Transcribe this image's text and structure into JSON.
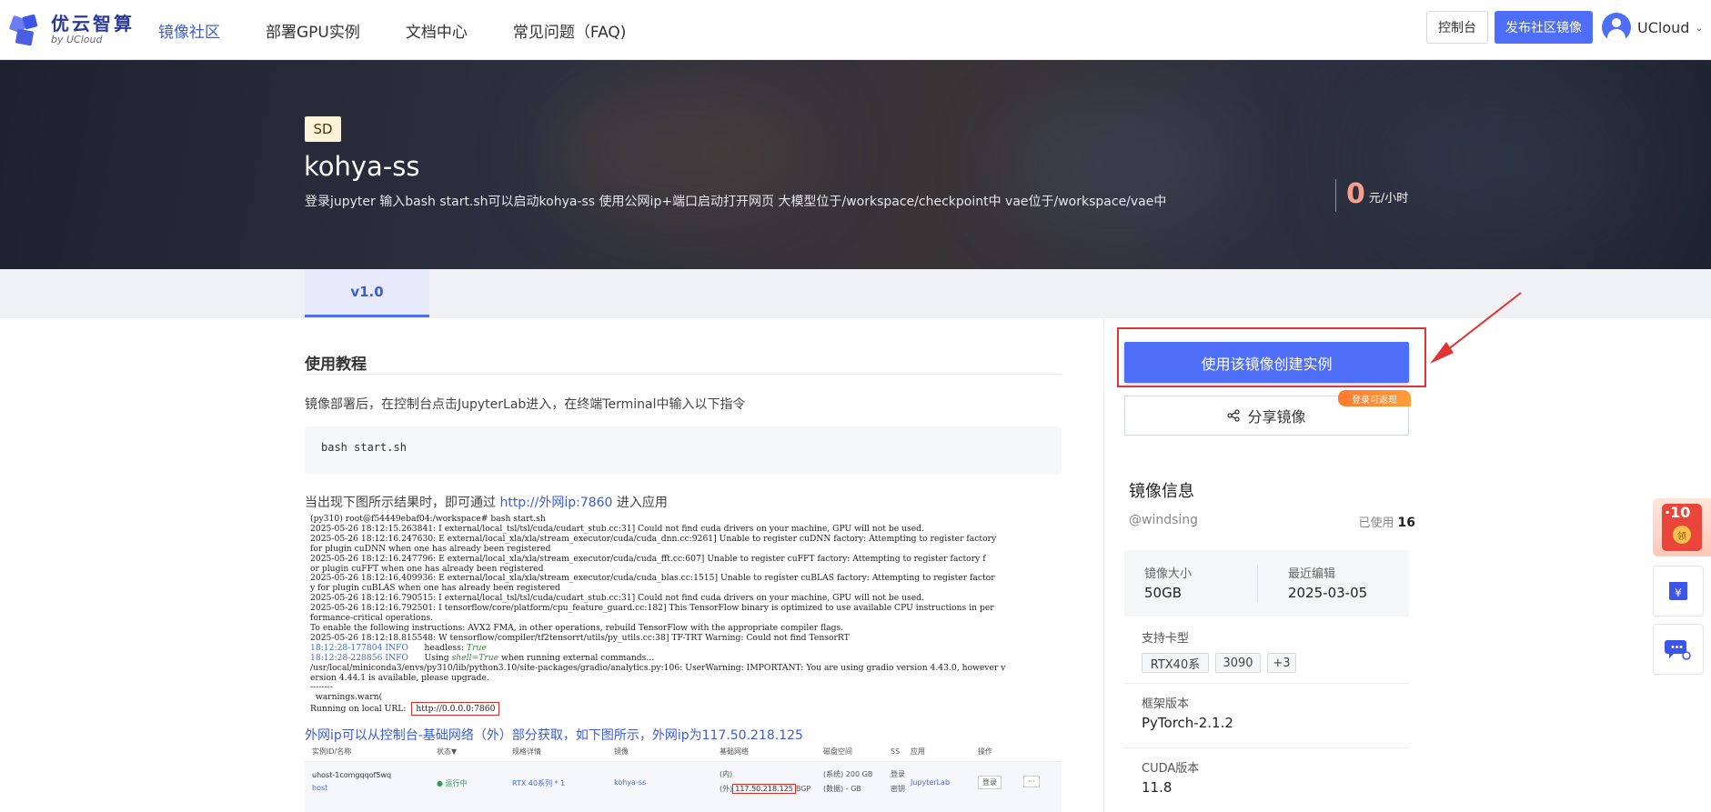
{
  "header": {
    "logo_main": "优云智算",
    "logo_sub": "by UCloud",
    "nav": [
      {
        "label": "镜像社区",
        "active": true
      },
      {
        "label": "部署GPU实例",
        "active": false
      },
      {
        "label": "文档中心",
        "active": false
      },
      {
        "label": "常见问题（FAQ)",
        "active": false
      }
    ],
    "console_btn": "控制台",
    "publish_btn": "发布社区镜像",
    "user_name": "UCloud"
  },
  "hero": {
    "tag": "SD",
    "title": "kohya-ss",
    "description": "登录jupyter 输入bash start.sh可以启动kohya-ss 使用公网ip+端口启动打开网页 大模型位于/workspace/checkpoint中 vae位于/workspace/vae中",
    "price_value": "0",
    "price_unit": "元/小时"
  },
  "tabs": [
    {
      "label": "v1.0",
      "active": true
    }
  ],
  "tutorial": {
    "title": "使用教程",
    "step1": "镜像部署后，在控制台点击JupyterLab进入，在终端Terminal中输入以下指令",
    "command": "bash start.sh",
    "step2_prefix": "当出现下图所示结果时，即可通过 ",
    "step2_link": "http://外网ip:7860",
    "step2_suffix": " 进入应用",
    "terminal_lines": [
      "(py310) root@f54449ebaf04:/workspace# bash start.sh",
      "2025-05-26 18:12:15.263841: I external/local_tsl/tsl/cuda/cudart_stub.cc:31] Could not find cuda drivers on your machine, GPU will not be used.",
      "2025-05-26 18:12:16.247630: E external/local_xla/xla/stream_executor/cuda/cuda_dnn.cc:9261] Unable to register cuDNN factory: Attempting to register factory",
      "for plugin cuDNN when one has already been registered",
      "2025-05-26 18:12:16.247796: E external/local_xla/xla/stream_executor/cuda/cuda_fft.cc:607] Unable to register cuFFT factory: Attempting to register factory f",
      "or plugin cuFFT when one has already been registered",
      "2025-05-26 18:12:16.409936: E external/local_xla/xla/stream_executor/cuda/cuda_blas.cc:1515] Unable to register cuBLAS factory: Attempting to register factor",
      "y for plugin cuBLAS when one has already been registered",
      "2025-05-26 18:12:16.790515: I external/local_tsl/tsl/cuda/cudart_stub.cc:31] Could not find cuda drivers on your machine, GPU will not be used.",
      "2025-05-26 18:12:16.792501: I tensorflow/core/platform/cpu_feature_guard.cc:182] This TensorFlow binary is optimized to use available CPU instructions in per",
      "formance-critical operations.",
      "To enable the following instructions: AVX2 FMA, in other operations, rebuild TensorFlow with the appropriate compiler flags.",
      "2025-05-26 18:12:18.815548: W tensorflow/compiler/tf2tensorrt/utils/py_utils.cc:38] TF-TRT Warning: Could not find TensorRT"
    ],
    "terminal_info1_time": "18:12:28-177804 INFO",
    "terminal_info1_key": "headless: ",
    "terminal_info1_val": "True",
    "terminal_info2_time": "18:12:28-228856 INFO",
    "terminal_info2_pre": "Using ",
    "terminal_info2_mid": "shell=True",
    "terminal_info2_post": " when running external commands...",
    "terminal_tail": [
      "/usr/local/miniconda3/envs/py310/lib/python3.10/site-packages/gradio/analytics.py:106: UserWarning: IMPORTANT: You are using gradio version 4.43.0, however v",
      "ersion 4.44.1 is available, please upgrade.",
      "--------",
      "  warnings.warn("
    ],
    "running_prefix": "Running on local URL:  ",
    "running_url": "http://0.0.0.0:7860",
    "step3": "外网ip可以从控制台-基础网络（外）部分获取，如下图所示，外网ip为117.50.218.125",
    "console_headers": [
      "实例ID/名称",
      "状态▼",
      "规格详情",
      "镜像",
      "基础网络",
      "磁盘空间",
      "SS",
      "应用",
      "操作"
    ],
    "console_row": {
      "name": "uhost-1comgqqof5wq",
      "sub": "host",
      "status": "● 运行中",
      "spec": "RTX 40系列 * 1",
      "image": "kohya-ss",
      "net_in": "(内)",
      "net_out_prefix": "(外)",
      "net_ip": "117.50.218.125",
      "net_suffix": "BGP",
      "disk1": "(系统) 200 GB",
      "disk2": "(数据) - GB",
      "ss1": "登录",
      "ss2": "密钥",
      "app": "JupyterLab",
      "op_login": "登录",
      "op_more": "···"
    }
  },
  "sidebar": {
    "create_btn": "使用该镜像创建实例",
    "share_btn": "分享镜像",
    "login_badge": "登录可返现",
    "info_title": "镜像信息",
    "author": "@windsing",
    "used_label": "已使用",
    "used_count": "16",
    "size_label": "镜像大小",
    "size_value": "50GB",
    "edit_label": "最近编辑",
    "edit_value": "2025-03-05",
    "gpu_label": "支持卡型",
    "gpus": [
      "RTX40系",
      "3090",
      "+3"
    ],
    "framework_label": "框架版本",
    "framework_value": "PyTorch-2.1.2",
    "cuda_label": "CUDA版本",
    "cuda_value": "11.8"
  },
  "floating": {
    "promo_num": "10",
    "promo_coin": "领"
  },
  "colors": {
    "primary": "#4f6ef7",
    "accent_red": "#e23434",
    "price": "#f7a08b"
  }
}
